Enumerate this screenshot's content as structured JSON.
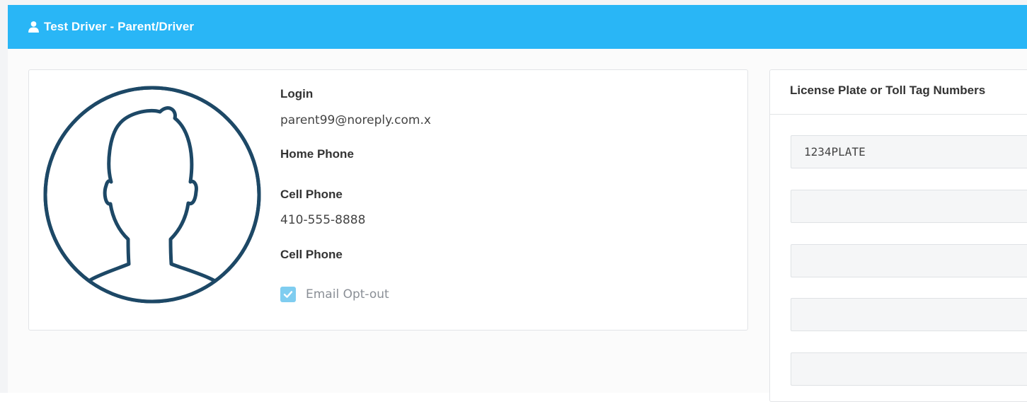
{
  "header": {
    "title": "Test Driver - Parent/Driver",
    "icon": "user-icon",
    "background_color": "#29b6f6"
  },
  "profile": {
    "avatar_icon": "user-silhouette-icon",
    "fields": {
      "login_label": "Login",
      "login_value": "parent99@noreply.com.x",
      "home_phone_label": "Home Phone",
      "home_phone_value": "",
      "cell_phone_label": "Cell Phone",
      "cell_phone_value": "410-555-8888",
      "cell_phone2_label": "Cell Phone",
      "cell_phone2_value": ""
    },
    "email_opt_out": {
      "label": "Email Opt-out",
      "checked": true,
      "color": "#7fcdf0"
    }
  },
  "plates": {
    "title": "License Plate or Toll Tag Numbers",
    "inputs": [
      {
        "value": "1234PLATE"
      },
      {
        "value": ""
      },
      {
        "value": ""
      },
      {
        "value": ""
      },
      {
        "value": ""
      }
    ]
  }
}
